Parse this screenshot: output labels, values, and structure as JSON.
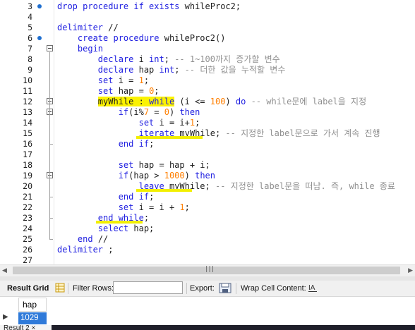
{
  "editor": {
    "lines": [
      {
        "n": "3",
        "bp": true,
        "segs": [
          [
            "kw",
            "drop procedure if exists "
          ],
          [
            "",
            "whileProc2;"
          ]
        ]
      },
      {
        "n": "4",
        "segs": []
      },
      {
        "n": "5",
        "segs": [
          [
            "kw",
            "delimiter"
          ],
          [
            "",
            " //"
          ]
        ]
      },
      {
        "n": "6",
        "bp": true,
        "segs": [
          [
            "",
            "    "
          ],
          [
            "kw",
            "create procedure "
          ],
          [
            "",
            "whileProc2()"
          ]
        ]
      },
      {
        "n": "7",
        "segs": [
          [
            "",
            "    "
          ],
          [
            "kw",
            "begin"
          ]
        ]
      },
      {
        "n": "8",
        "segs": [
          [
            "",
            "        "
          ],
          [
            "kw",
            "declare "
          ],
          [
            "",
            "i "
          ],
          [
            "kw",
            "int"
          ],
          [
            "",
            ";"
          ],
          [
            "cm",
            " -- 1~100까지 증가할 변수"
          ]
        ]
      },
      {
        "n": "9",
        "segs": [
          [
            "",
            "        "
          ],
          [
            "kw",
            "declare "
          ],
          [
            "",
            "hap "
          ],
          [
            "kw",
            "int"
          ],
          [
            "",
            ";"
          ],
          [
            "cm",
            " -- 더한 값을 누적할 변수"
          ]
        ]
      },
      {
        "n": "10",
        "segs": [
          [
            "",
            "        "
          ],
          [
            "kw",
            "set "
          ],
          [
            "",
            "i = "
          ],
          [
            "num",
            "1"
          ],
          [
            "",
            ";"
          ]
        ]
      },
      {
        "n": "11",
        "segs": [
          [
            "",
            "        "
          ],
          [
            "kw",
            "set "
          ],
          [
            "",
            "hap = "
          ],
          [
            "num",
            "0"
          ],
          [
            "",
            ";"
          ]
        ]
      },
      {
        "n": "12",
        "segs": [
          [
            "",
            "        "
          ],
          [
            "hl",
            "myWhile : "
          ],
          [
            "hlkw",
            "while"
          ],
          [
            "",
            " (i <= "
          ],
          [
            "num",
            "100"
          ],
          [
            "",
            ") "
          ],
          [
            "kw",
            "do"
          ],
          [
            "cm",
            " -- while문에 label을 지정"
          ]
        ]
      },
      {
        "n": "13",
        "segs": [
          [
            "",
            "            "
          ],
          [
            "kw",
            "if"
          ],
          [
            "",
            "(i%"
          ],
          [
            "num",
            "7"
          ],
          [
            "",
            " = "
          ],
          [
            "num",
            "0"
          ],
          [
            "",
            ") "
          ],
          [
            "kw",
            "then"
          ]
        ]
      },
      {
        "n": "14",
        "segs": [
          [
            "",
            "                "
          ],
          [
            "kw",
            "set "
          ],
          [
            "",
            "i = i+"
          ],
          [
            "num",
            "1"
          ],
          [
            "",
            ";"
          ]
        ]
      },
      {
        "n": "15",
        "segs": [
          [
            "",
            "                "
          ],
          [
            "kw",
            "iterate "
          ],
          [
            "",
            "myWhile;"
          ],
          [
            "cm",
            " -- 지정한 label문으로 가서 계속 진행"
          ]
        ]
      },
      {
        "n": "16",
        "segs": [
          [
            "",
            "            "
          ],
          [
            "kw",
            "end if"
          ],
          [
            "",
            ";"
          ]
        ]
      },
      {
        "n": "17",
        "segs": []
      },
      {
        "n": "18",
        "segs": [
          [
            "",
            "            "
          ],
          [
            "kw",
            "set "
          ],
          [
            "",
            "hap = hap + i;"
          ]
        ]
      },
      {
        "n": "19",
        "segs": [
          [
            "",
            "            "
          ],
          [
            "kw",
            "if"
          ],
          [
            "",
            "(hap > "
          ],
          [
            "num",
            "1000"
          ],
          [
            "",
            ") "
          ],
          [
            "kw",
            "then"
          ]
        ]
      },
      {
        "n": "20",
        "segs": [
          [
            "",
            "                "
          ],
          [
            "kw",
            "leave "
          ],
          [
            "",
            "myWhile;"
          ],
          [
            "cm",
            " -- 지정한 label문을 떠남. 즉, while 종료"
          ]
        ]
      },
      {
        "n": "21",
        "segs": [
          [
            "",
            "            "
          ],
          [
            "kw",
            "end if"
          ],
          [
            "",
            ";"
          ]
        ]
      },
      {
        "n": "22",
        "segs": [
          [
            "",
            "            "
          ],
          [
            "kw",
            "set "
          ],
          [
            "",
            "i = i + "
          ],
          [
            "num",
            "1"
          ],
          [
            "",
            ";"
          ]
        ]
      },
      {
        "n": "23",
        "segs": [
          [
            "",
            "        "
          ],
          [
            "kw",
            "end while"
          ],
          [
            "",
            ";"
          ]
        ]
      },
      {
        "n": "24",
        "segs": [
          [
            "",
            "        "
          ],
          [
            "kw",
            "select "
          ],
          [
            "",
            "hap;"
          ]
        ]
      },
      {
        "n": "25",
        "segs": [
          [
            "",
            "    "
          ],
          [
            "kw",
            "end"
          ],
          [
            "",
            " //"
          ]
        ]
      },
      {
        "n": "26",
        "segs": [
          [
            "kw",
            "delimiter"
          ],
          [
            "",
            " ;"
          ]
        ]
      },
      {
        "n": "27",
        "segs": []
      }
    ]
  },
  "scrollbar": {
    "left_arrow": "◀",
    "right_arrow": "▶",
    "grip": "|||"
  },
  "toolbar": {
    "result_grid": "Result Grid",
    "filter_rows": "Filter Rows:",
    "filter_value": "",
    "export": "Export:",
    "wrap": "Wrap Cell Content:",
    "grid_icon": "grid-icon",
    "export_icon": "export-icon",
    "wrap_icon": "wrap-icon"
  },
  "grid": {
    "columns": [
      "hap"
    ],
    "rows": [
      [
        "1029"
      ]
    ],
    "row_indicator": "▶"
  },
  "tabs": {
    "result_tab": "Result 2 ×"
  },
  "colors": {
    "keyword": "#1d1de0",
    "number": "#ff7f00",
    "comment": "#909090",
    "highlight": "#fbf200",
    "selection": "#2f7ad9"
  }
}
